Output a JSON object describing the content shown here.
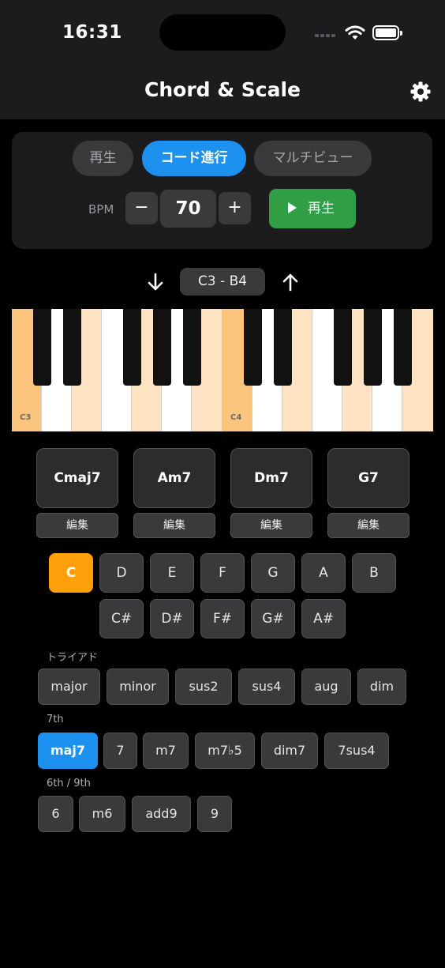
{
  "status": {
    "time": "16:31"
  },
  "nav": {
    "title": "Chord & Scale",
    "settings_icon": "gear-icon"
  },
  "tabs": [
    {
      "label": "再生",
      "active": false
    },
    {
      "label": "コード進行",
      "active": true
    },
    {
      "label": "マルチビュー",
      "active": false
    }
  ],
  "bpm": {
    "label": "BPM",
    "minus": "−",
    "value": "70",
    "plus": "+"
  },
  "play": {
    "label": "再生"
  },
  "range": {
    "label": "C3 - B4",
    "down_icon": "arrow-down-icon",
    "up_icon": "arrow-up-icon"
  },
  "keyboard": {
    "white_keys": [
      "C3",
      "D3",
      "E3",
      "F3",
      "G3",
      "A3",
      "B3",
      "C4",
      "D4",
      "E4",
      "F4",
      "G4",
      "A4",
      "B4"
    ],
    "highlighted": [
      "C3",
      "C4"
    ],
    "labels": {
      "C3": "C3",
      "C4": "C4"
    }
  },
  "progression": [
    {
      "chord": "Cmaj7",
      "edit": "編集"
    },
    {
      "chord": "Am7",
      "edit": "編集"
    },
    {
      "chord": "Dm7",
      "edit": "編集"
    },
    {
      "chord": "G7",
      "edit": "編集"
    }
  ],
  "roots": {
    "naturals": [
      "C",
      "D",
      "E",
      "F",
      "G",
      "A",
      "B"
    ],
    "sharps": [
      "C#",
      "D#",
      "F#",
      "G#",
      "A#"
    ],
    "selected": "C"
  },
  "qualities": {
    "triad": {
      "title": "トライアド",
      "items": [
        "major",
        "minor",
        "sus2",
        "sus4",
        "aug",
        "dim"
      ]
    },
    "seventh": {
      "title": "7th",
      "items": [
        "maj7",
        "7",
        "m7",
        "m7♭5",
        "dim7",
        "7sus4"
      ]
    },
    "sixth_ninth": {
      "title": "6th / 9th",
      "items": [
        "6",
        "m6",
        "add9",
        "9"
      ]
    },
    "selected": "maj7"
  },
  "colors": {
    "accent_blue": "#1d91f0",
    "root_selected": "#ff9f0a",
    "play_green": "#2f9e44",
    "key_highlight": "#fbc57d",
    "key_light": "#fde3c2"
  }
}
